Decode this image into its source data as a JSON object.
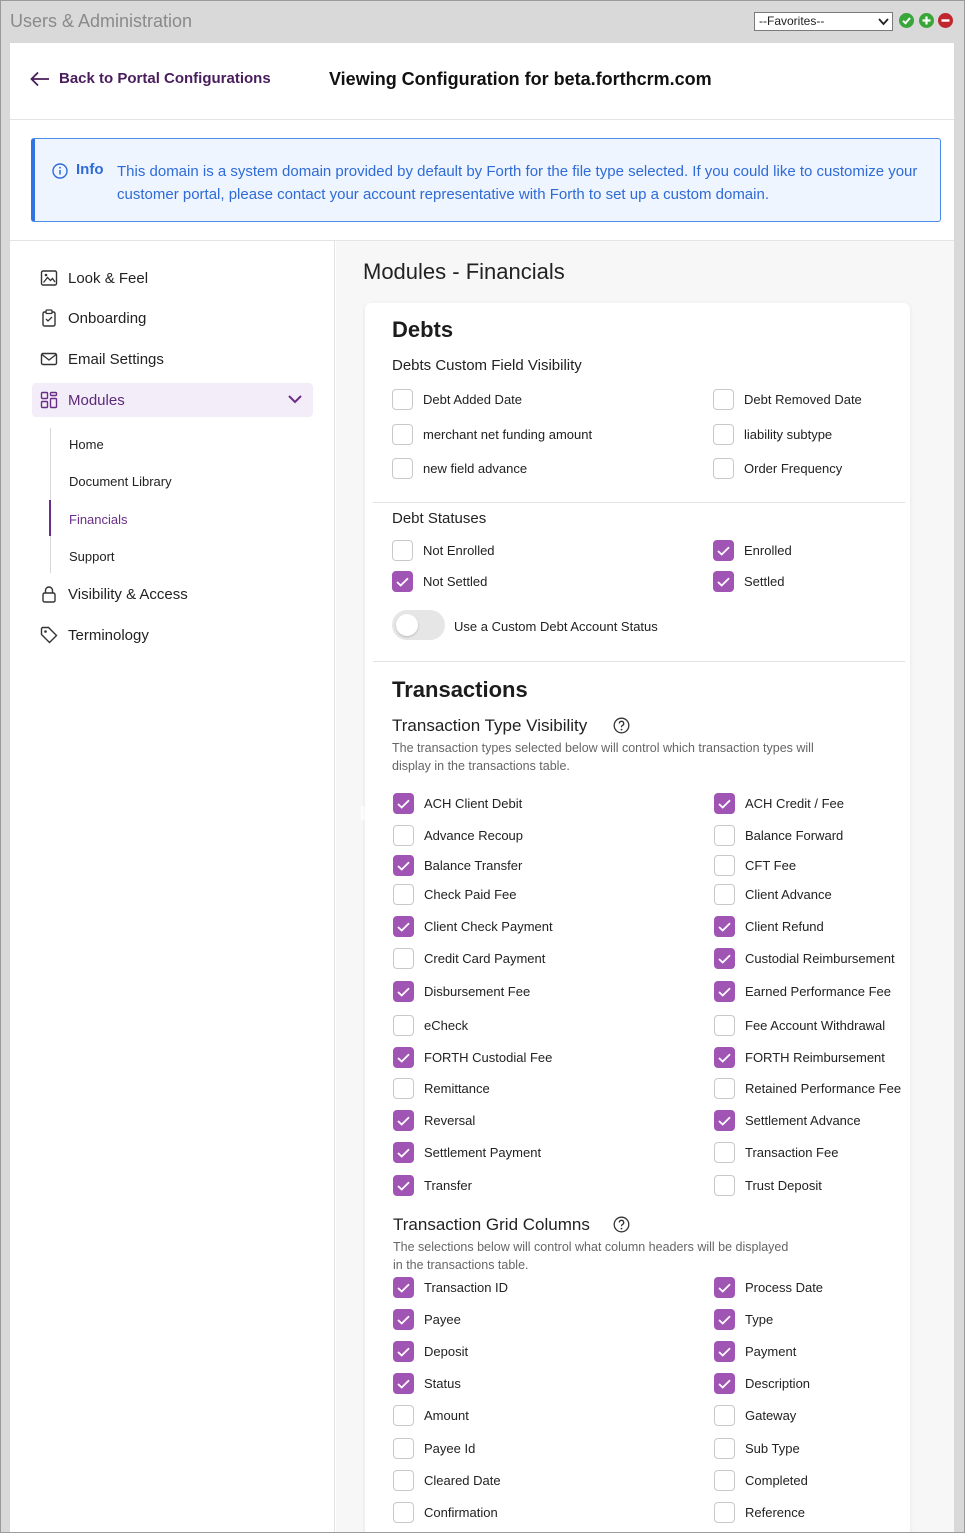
{
  "titlebar": {
    "title": "Users & Administration",
    "favorites_value": "--Favorites--"
  },
  "header": {
    "back_label": "Back to Portal Configurations",
    "title": "Viewing Configuration for beta.forthcrm.com"
  },
  "info": {
    "label": "Info",
    "text": "This domain is a system domain provided by default by Forth for the file type selected. If you could like to customize your customer portal, please contact your account representative with Forth to set up a custom domain."
  },
  "sidebar": {
    "items": [
      {
        "label": "Look & Feel",
        "icon": "image-icon"
      },
      {
        "label": "Onboarding",
        "icon": "clipboard-icon"
      },
      {
        "label": "Email Settings",
        "icon": "envelope-icon"
      },
      {
        "label": "Modules",
        "icon": "grid-icon"
      },
      {
        "label": "Visibility & Access",
        "icon": "lock-icon"
      },
      {
        "label": "Terminology",
        "icon": "tag-icon"
      }
    ],
    "sub_items": [
      "Home",
      "Document Library",
      "Financials",
      "Support"
    ]
  },
  "main": {
    "title": "Modules - Financials",
    "debts": {
      "heading": "Debts",
      "custom_field_heading": "Debts Custom Field Visibility",
      "custom_fields": [
        {
          "label": "Debt Added Date",
          "checked": false
        },
        {
          "label": "Debt Removed Date",
          "checked": false
        },
        {
          "label": "merchant net funding amount",
          "checked": false
        },
        {
          "label": "liability subtype",
          "checked": false
        },
        {
          "label": "new field advance",
          "checked": false
        },
        {
          "label": "Order Frequency",
          "checked": false
        }
      ],
      "statuses_heading": "Debt Statuses",
      "statuses": [
        {
          "label": "Not Enrolled",
          "checked": false
        },
        {
          "label": "Enrolled",
          "checked": true
        },
        {
          "label": "Not Settled",
          "checked": true
        },
        {
          "label": "Settled",
          "checked": true
        }
      ],
      "toggle_label": "Use a Custom Debt Account Status",
      "toggle_on": false
    },
    "transactions": {
      "heading": "Transactions",
      "type_heading": "Transaction Type Visibility",
      "type_note_line1": "The transaction types selected below will control which transaction types will",
      "type_note_line2": "display in the transactions table.",
      "types": [
        {
          "label": "ACH Client Debit",
          "checked": true
        },
        {
          "label": "ACH Credit / Fee",
          "checked": true
        },
        {
          "label": "Advance Recoup",
          "checked": false
        },
        {
          "label": "Balance Forward",
          "checked": false
        },
        {
          "label": "Balance Transfer",
          "checked": true
        },
        {
          "label": "CFT Fee",
          "checked": false
        },
        {
          "label": "Check Paid Fee",
          "checked": false
        },
        {
          "label": "Client Advance",
          "checked": false
        },
        {
          "label": "Client Check Payment",
          "checked": true
        },
        {
          "label": "Client Refund",
          "checked": true
        },
        {
          "label": "Credit Card Payment",
          "checked": false
        },
        {
          "label": "Custodial Reimbursement",
          "checked": true
        },
        {
          "label": "Disbursement Fee",
          "checked": true
        },
        {
          "label": "Earned Performance Fee",
          "checked": true
        },
        {
          "label": "eCheck",
          "checked": false
        },
        {
          "label": "Fee Account Withdrawal",
          "checked": false
        },
        {
          "label": "FORTH Custodial Fee",
          "checked": true
        },
        {
          "label": "FORTH Reimbursement",
          "checked": true
        },
        {
          "label": "Remittance",
          "checked": false
        },
        {
          "label": "Retained Performance Fee",
          "checked": false
        },
        {
          "label": "Reversal",
          "checked": true
        },
        {
          "label": "Settlement Advance",
          "checked": true
        },
        {
          "label": "Settlement Payment",
          "checked": true
        },
        {
          "label": "Transaction Fee",
          "checked": false
        },
        {
          "label": "Transfer",
          "checked": true
        },
        {
          "label": "Trust Deposit",
          "checked": false
        }
      ],
      "grid_heading": "Transaction Grid Columns",
      "grid_note_line1": "The selections below will control what column headers will be displayed",
      "grid_note_line2": "in the transactions table.",
      "grid_columns": [
        {
          "label": "Transaction ID",
          "checked": true
        },
        {
          "label": "Process Date",
          "checked": true
        },
        {
          "label": "Payee",
          "checked": true
        },
        {
          "label": "Type",
          "checked": true
        },
        {
          "label": "Deposit",
          "checked": true
        },
        {
          "label": "Payment",
          "checked": true
        },
        {
          "label": "Status",
          "checked": true
        },
        {
          "label": "Description",
          "checked": true
        },
        {
          "label": "Amount",
          "checked": false
        },
        {
          "label": "Gateway",
          "checked": false
        },
        {
          "label": "Payee Id",
          "checked": false
        },
        {
          "label": "Sub Type",
          "checked": false
        },
        {
          "label": "Cleared Date",
          "checked": false
        },
        {
          "label": "Completed",
          "checked": false
        },
        {
          "label": "Confirmation",
          "checked": false
        },
        {
          "label": "Reference",
          "checked": false
        }
      ]
    }
  },
  "colors": {
    "accent": "#a054b4",
    "nav_active_bg": "#f3ecf9",
    "info_blue": "#2f6bd6"
  }
}
